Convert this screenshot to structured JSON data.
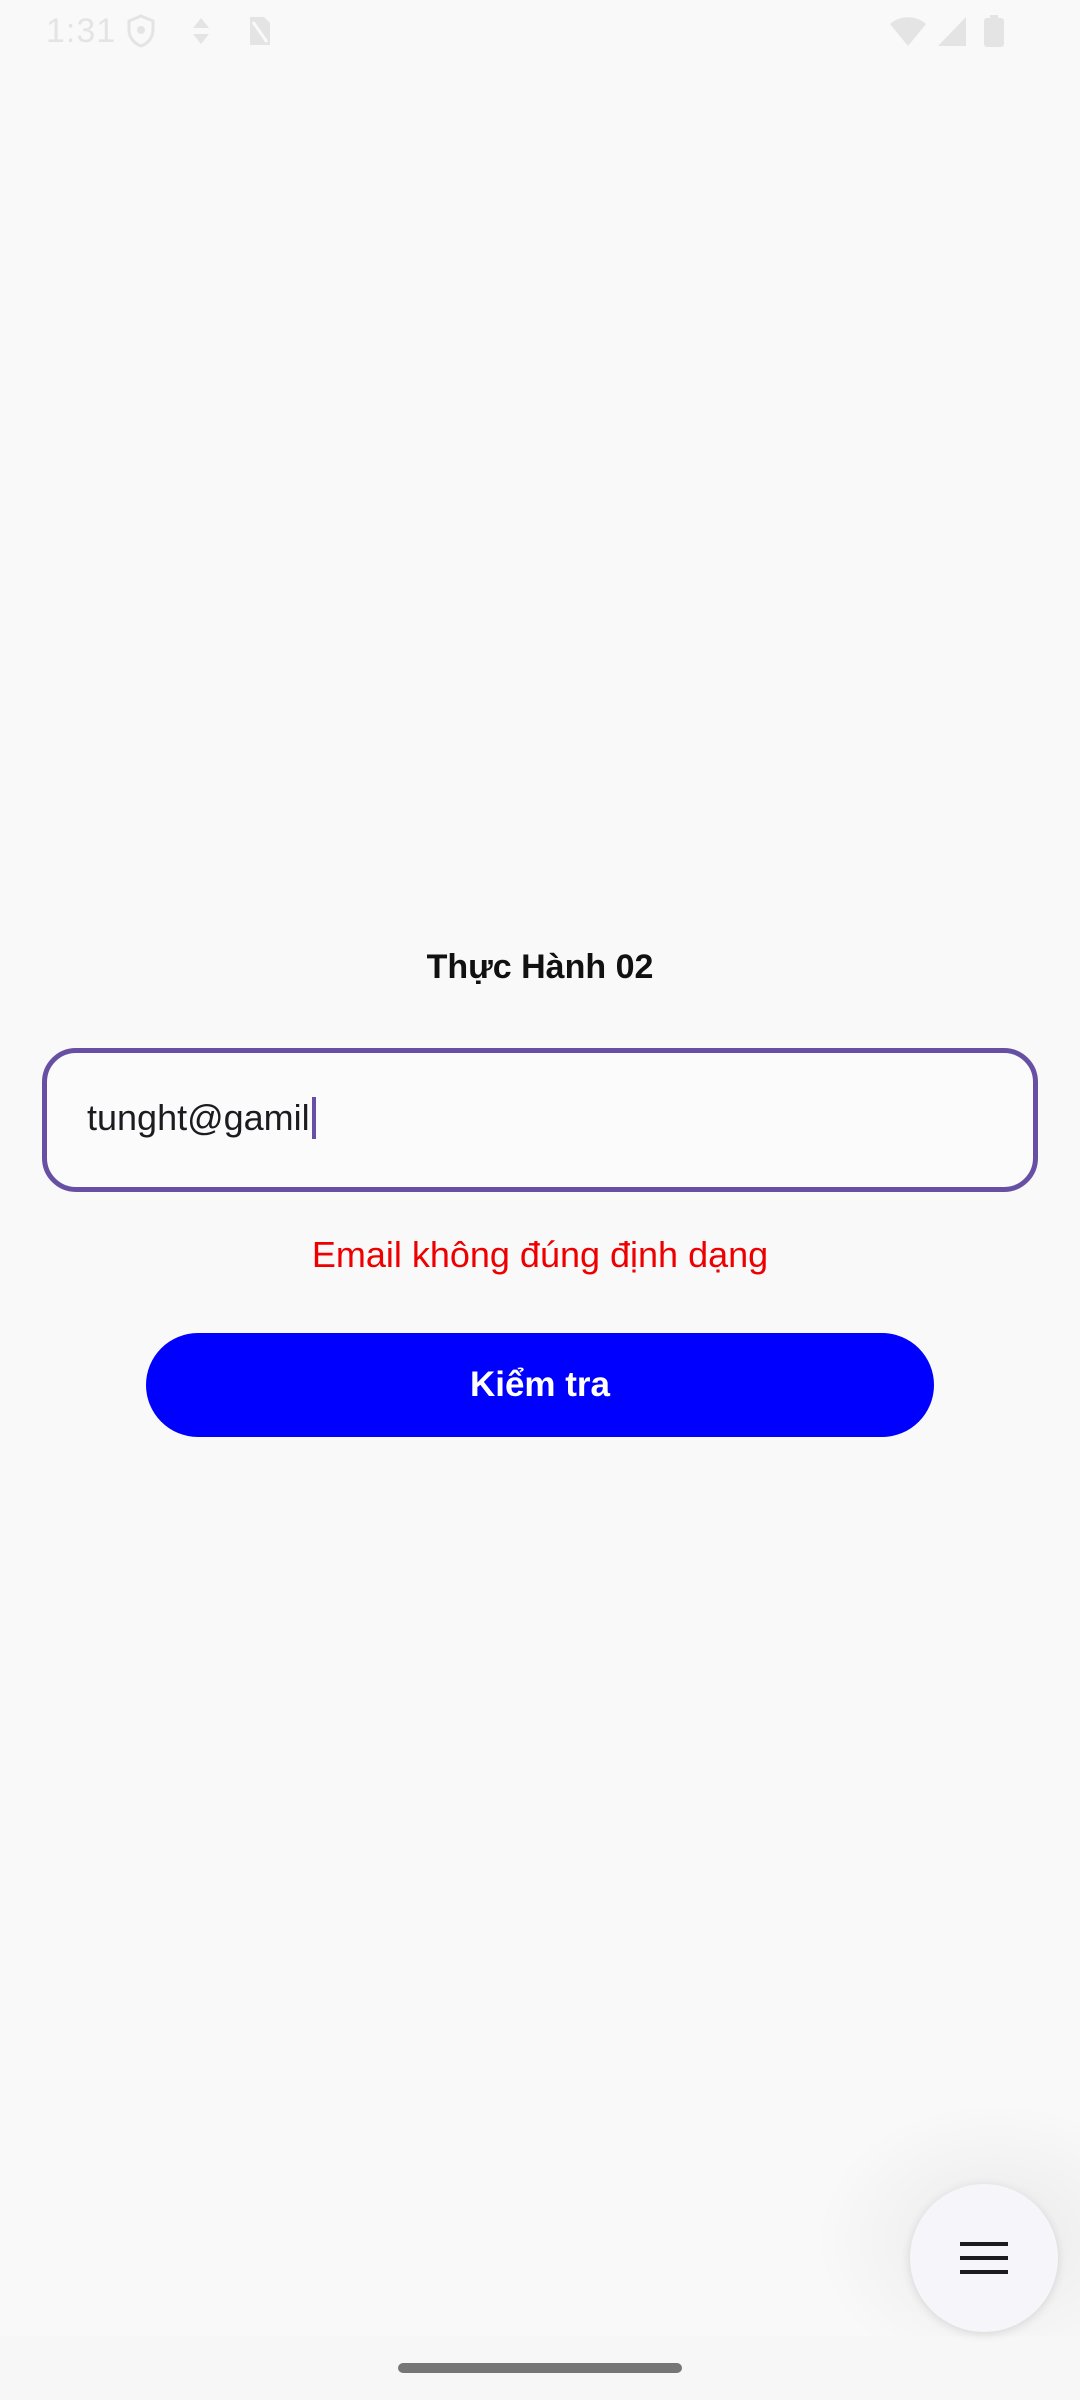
{
  "status_bar": {
    "time": "1:31",
    "icons": [
      "shield-icon",
      "data-saver-icon",
      "no-sim-icon",
      "wifi-icon",
      "signal-icon",
      "battery-icon"
    ]
  },
  "main": {
    "title": "Thực Hành 02",
    "email_input": {
      "value": "tunght@gamil",
      "focused": true
    },
    "error_message": "Email không đúng định dạng",
    "check_button_label": "Kiểm tra"
  },
  "fab": {
    "icon": "menu-icon"
  },
  "colors": {
    "background": "#f9f9f9",
    "input_border": "#6750a4",
    "error": "#ee0000",
    "button": "#0000ff",
    "button_text": "#ffffff"
  }
}
